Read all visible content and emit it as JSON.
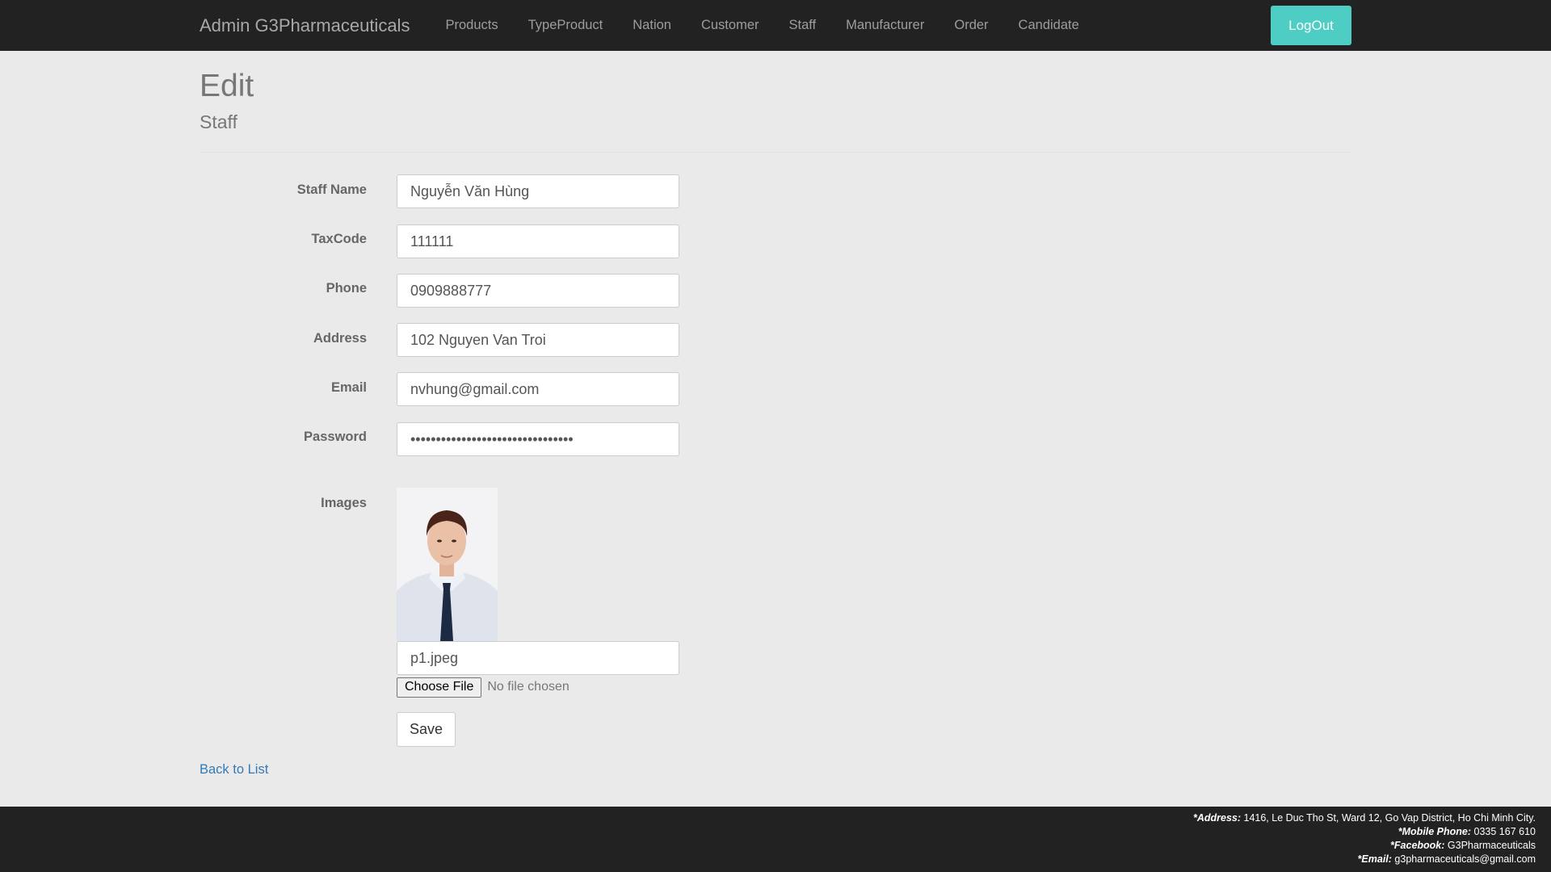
{
  "navbar": {
    "brand": "Admin G3Pharmaceuticals",
    "links": [
      "Products",
      "TypeProduct",
      "Nation",
      "Customer",
      "Staff",
      "Manufacturer",
      "Order",
      "Candidate"
    ],
    "logout_label": "LogOut",
    "accent_color": "#4ecdc4",
    "background_color": "#222222"
  },
  "page": {
    "title": "Edit",
    "subtitle": "Staff"
  },
  "form": {
    "staff_name": {
      "label": "Staff Name",
      "value": "Nguyễn Văn Hùng"
    },
    "tax_code": {
      "label": "TaxCode",
      "value": "111111"
    },
    "phone": {
      "label": "Phone",
      "value": "0909888777"
    },
    "address": {
      "label": "Address",
      "value": "102 Nguyen Van Troi"
    },
    "email": {
      "label": "Email",
      "value": "nvhung@gmail.com"
    },
    "password": {
      "label": "Password",
      "value": "••••••••••••••••••••••••••••••••"
    },
    "images": {
      "label": "Images",
      "filename": "p1.jpeg",
      "choose_file_label": "Choose File",
      "no_file_text": "No file chosen"
    },
    "save_label": "Save"
  },
  "back_link": "Back to List",
  "footer": {
    "address_label": "*Address:",
    "address_value": "1416, Le Duc Tho St, Ward 12, Go Vap District, Ho Chi Minh City.",
    "phone_label": "*Mobile Phone:",
    "phone_value": "0335 167 610",
    "facebook_label": "*Facebook:",
    "facebook_value": "G3Pharmaceuticals",
    "email_label": "*Email:",
    "email_value": "g3pharmaceuticals@gmail.com"
  }
}
